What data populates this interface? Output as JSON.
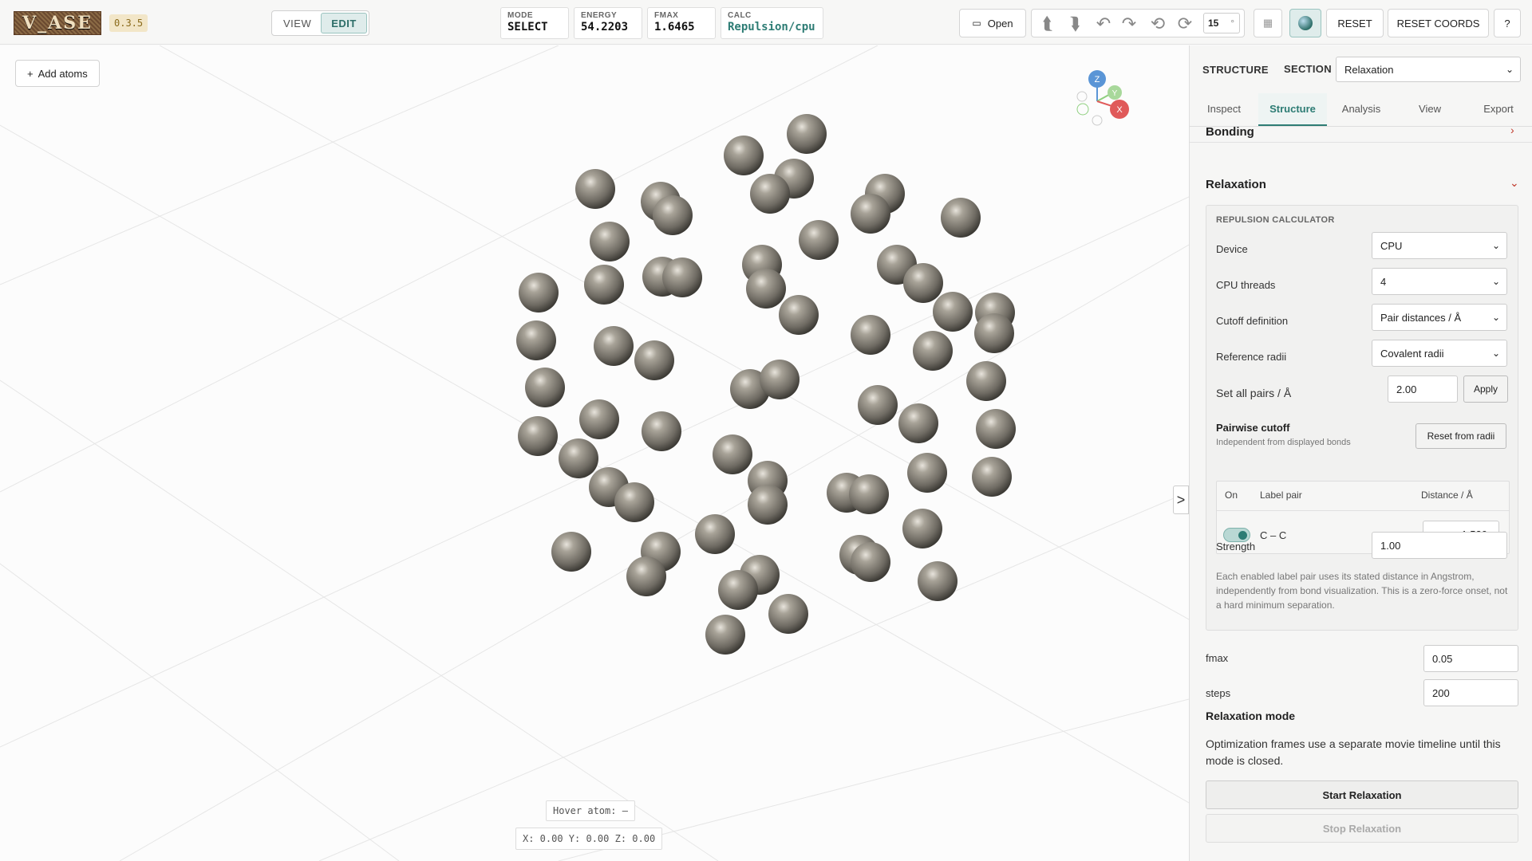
{
  "app": {
    "logo_text": "V_ASE",
    "version": "0.3.5"
  },
  "mode_switch": {
    "view_label": "VIEW",
    "edit_label": "EDIT",
    "active": "EDIT"
  },
  "stats": {
    "mode": {
      "label": "MODE",
      "value": "SELECT"
    },
    "energy": {
      "label": "ENERGY",
      "value": "54.2203"
    },
    "fmax": {
      "label": "FMAX",
      "value": "1.6465"
    },
    "calc": {
      "label": "CALC",
      "value": "Repulsion/cpu"
    }
  },
  "toolbar": {
    "open_label": "Open",
    "open_icon": "folder-icon",
    "step_value": "15",
    "step_unit": "°",
    "reset_label": "RESET",
    "reset_coords_label": "RESET COORDS",
    "help_label": "?"
  },
  "viewport": {
    "add_atoms_label": "Add atoms",
    "hover_atom": "Hover atom: –",
    "coords": "X: 0.00  Y: 0.00  Z: 0.00",
    "axes": {
      "z": "Z",
      "y": "Y",
      "x": "X"
    },
    "collapse_icon": ">"
  },
  "sidebar": {
    "structure_label": "STRUCTURE",
    "section_label": "SECTION",
    "section_value": "Relaxation",
    "tabs": [
      "Inspect",
      "Structure",
      "Analysis",
      "View",
      "Export"
    ],
    "active_tab": "Structure",
    "bonding_title": "Bonding",
    "relaxation_title": "Relaxation",
    "calculator": {
      "heading": "REPULSION CALCULATOR",
      "device_label": "Device",
      "device_value": "CPU",
      "threads_label": "CPU threads",
      "threads_value": "4",
      "cutoff_label": "Cutoff definition",
      "cutoff_value": "Pair distances / Å",
      "radii_label": "Reference radii",
      "radii_value": "Covalent radii",
      "setall_label": "Set all pairs / Å",
      "setall_value": "2.00",
      "apply_label": "Apply",
      "pairwise_title": "Pairwise cutoff",
      "pairwise_sub": "Independent from displayed bonds",
      "reset_radii_label": "Reset from radii",
      "table_headers": {
        "on": "On",
        "pair": "Label pair",
        "distance": "Distance / Å"
      },
      "pairs": [
        {
          "enabled": true,
          "label": "C – C",
          "distance": "1.520"
        }
      ],
      "strength_label": "Strength",
      "strength_value": "1.00",
      "note": "Each enabled label pair uses its stated distance in Angstrom, independently from bond visualization. This is a zero-force onset, not a hard minimum separation."
    },
    "fmax_label": "fmax",
    "fmax_value": "0.05",
    "steps_label": "steps",
    "steps_value": "200",
    "mode_title": "Relaxation mode",
    "mode_text": "Optimization frames use a separate movie timeline until this mode is closed.",
    "start_label": "Start Relaxation",
    "stop_label": "Stop Relaxation"
  },
  "colors": {
    "accent": "#2d7c74",
    "atom": "#8a857c",
    "axis_x": "#e05a5a",
    "axis_y": "#8fcf7f",
    "axis_z": "#5a95d6"
  }
}
